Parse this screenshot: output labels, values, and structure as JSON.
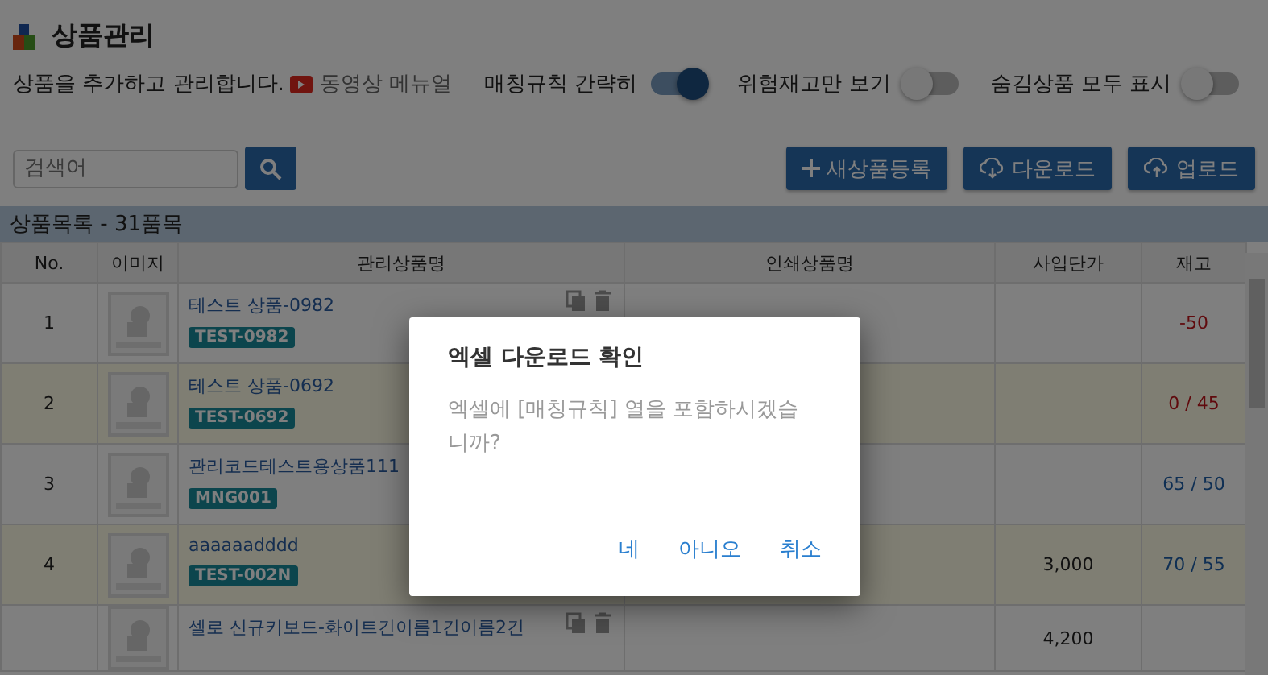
{
  "header": {
    "title": "상품관리",
    "description": "상품을 추가하고 관리합니다.",
    "video_link": "동영상 메뉴얼"
  },
  "toggles": [
    {
      "label": "매칭규칙 간략히",
      "on": true
    },
    {
      "label": "위험재고만 보기",
      "on": false
    },
    {
      "label": "숨김상품 모두 표시",
      "on": false
    }
  ],
  "search": {
    "placeholder": "검색어"
  },
  "buttons": [
    {
      "kind": "add",
      "label": "새상품등록"
    },
    {
      "kind": "download",
      "label": "다운로드"
    },
    {
      "kind": "upload",
      "label": "업로드"
    }
  ],
  "list_title": "상품목록 - 31품목",
  "table": {
    "columns": [
      "No.",
      "이미지",
      "관리상품명",
      "인쇄상품명",
      "사입단가",
      "재고"
    ],
    "rows": [
      {
        "no": "1",
        "name": "테스트 상품-0982",
        "code": "TEST-0982",
        "price": "",
        "stock": "-50",
        "low_stock": true
      },
      {
        "no": "2",
        "name": "테스트 상품-0692",
        "code": "TEST-0692",
        "price": "",
        "stock": "0 / 45",
        "low_stock": true
      },
      {
        "no": "3",
        "name": "관리코드테스트용상품111",
        "code": "MNG001",
        "price": "",
        "stock": "65 / 50",
        "low_stock": false
      },
      {
        "no": "4",
        "name": "aaaaaadddd",
        "code": "TEST-002N",
        "price": "3,000",
        "stock": "70 / 55",
        "low_stock": false
      },
      {
        "no": "",
        "name": "셀로 신규키보드-화이트긴이름1긴이름2긴",
        "code": "",
        "price": "4,200",
        "stock": ""
      }
    ]
  },
  "dialog": {
    "title": "엑셀 다운로드 확인",
    "message": "엑셀에 [매칭규칙] 열을 포함하시겠습니까?",
    "buttons": [
      "네",
      "아니오",
      "취소"
    ]
  }
}
